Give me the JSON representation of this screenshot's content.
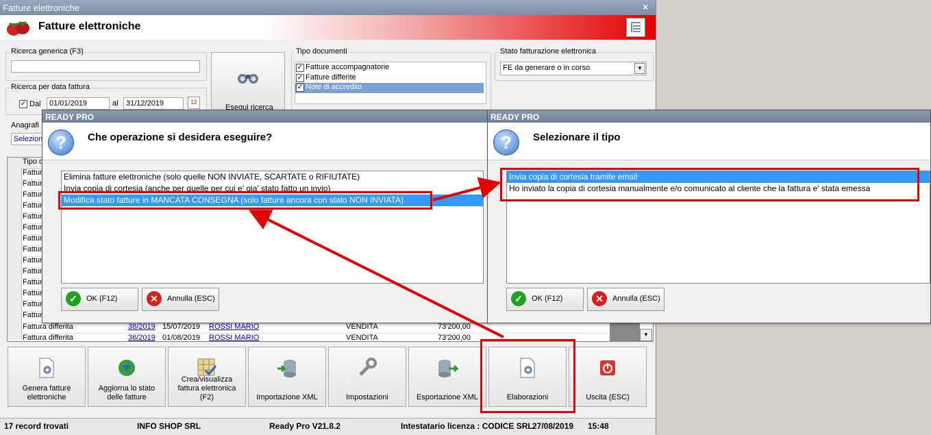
{
  "window": {
    "title": "Fatture elettroniche",
    "header": "Fatture elettroniche",
    "close": "×"
  },
  "search": {
    "generic_label": "Ricerca generica (F3)",
    "generic_value": "",
    "date_label": "Ricerca per data fattura",
    "dal_label": "Dal",
    "dal_checked": true,
    "dal_value": "01/01/2019",
    "al_label": "al",
    "al_value": "31/12/2019",
    "cal_icon": "12",
    "anagrafica_label": "Anagrafi",
    "anagrafica_value": "Selezion",
    "search_button": "Esegui ricerca"
  },
  "tipo_documenti": {
    "label": "Tipo documenti",
    "items": [
      {
        "label": "Fatture accompagnatorie",
        "checked": true
      },
      {
        "label": "Fatture differite",
        "checked": true
      },
      {
        "label": "Note di accredito",
        "checked": true
      }
    ]
  },
  "stato": {
    "label": "Stato fatturazione elettronica",
    "value": "FE da generare o in corso"
  },
  "grid": {
    "header": "Tipo d",
    "partial_rows": [
      "Fattur",
      "Fattur",
      "Fattur",
      "Fattur",
      "Fattur",
      "Fattur",
      "Fattur",
      "Fattur",
      "Fattur",
      "Fattur",
      "Fattur",
      "Fattur",
      "Fattur",
      "Fattur"
    ],
    "rows": [
      {
        "tipo": "Fattura differita",
        "numero": "38/2019",
        "data": "15/07/2019",
        "cliente": "ROSSI MARIO",
        "causale": "VENDITA",
        "importo": "73'200,00"
      },
      {
        "tipo": "Fattura differita",
        "numero": "36/2019",
        "data": "01/08/2019",
        "cliente": "ROSSI MARIO",
        "causale": "VENDITA",
        "importo": "73'200,00"
      }
    ]
  },
  "toolbar": [
    {
      "label": "Genera fatture elettroniche",
      "icon": "document-gear-icon"
    },
    {
      "label": "Aggiorna lo stato delle fatture",
      "icon": "globe-arrow-icon"
    },
    {
      "label": "Crea/visualizza fattura elettronica (F2)",
      "icon": "grid-check-icon"
    },
    {
      "label": "Importazione XML",
      "icon": "database-import-icon"
    },
    {
      "label": "Impostazioni",
      "icon": "wrench-icon"
    },
    {
      "label": "Esportazione XML",
      "icon": "database-export-icon"
    },
    {
      "label": "Elaborazioni",
      "icon": "document-gear-icon"
    },
    {
      "label": "Uscita (ESC)",
      "icon": "power-icon"
    }
  ],
  "status": {
    "records": "17 record trovati",
    "company": "INFO SHOP SRL",
    "version": "Ready Pro V21.8.2",
    "license": "Intestatario licenza : CODICE SRL",
    "date": "27/08/2019",
    "time": "15:48"
  },
  "dialog1": {
    "title": "READY PRO",
    "question": "Che operazione si desidera eseguire?",
    "items": [
      "Elimina fatture elettroniche (solo quelle NON INVIATE, SCARTATE o RIFIUTATE)",
      "Invia copia di cortesia (anche per quelle per cui e' gia' stato fatto un invio)",
      "Modifica stato fatture in MANCATA CONSEGNA (solo fatture ancora con stato NON INVIATA)"
    ],
    "selected": 2,
    "ok": "OK (F12)",
    "cancel": "Annulla (ESC)"
  },
  "dialog2": {
    "title": "READY PRO",
    "question": "Selezionare il tipo",
    "items": [
      "Invia copia di cortesia tramite email",
      "Ho inviato la copia di cortesia manualmente e/o comunicato al cliente che la fattura e' stata emessa"
    ],
    "selected": 0,
    "ok": "OK (F12)",
    "cancel": "Annulla (ESC)"
  },
  "colors": {
    "highlight": "#3399ff",
    "annotation": "#e00000",
    "header_red": "#e10000"
  }
}
